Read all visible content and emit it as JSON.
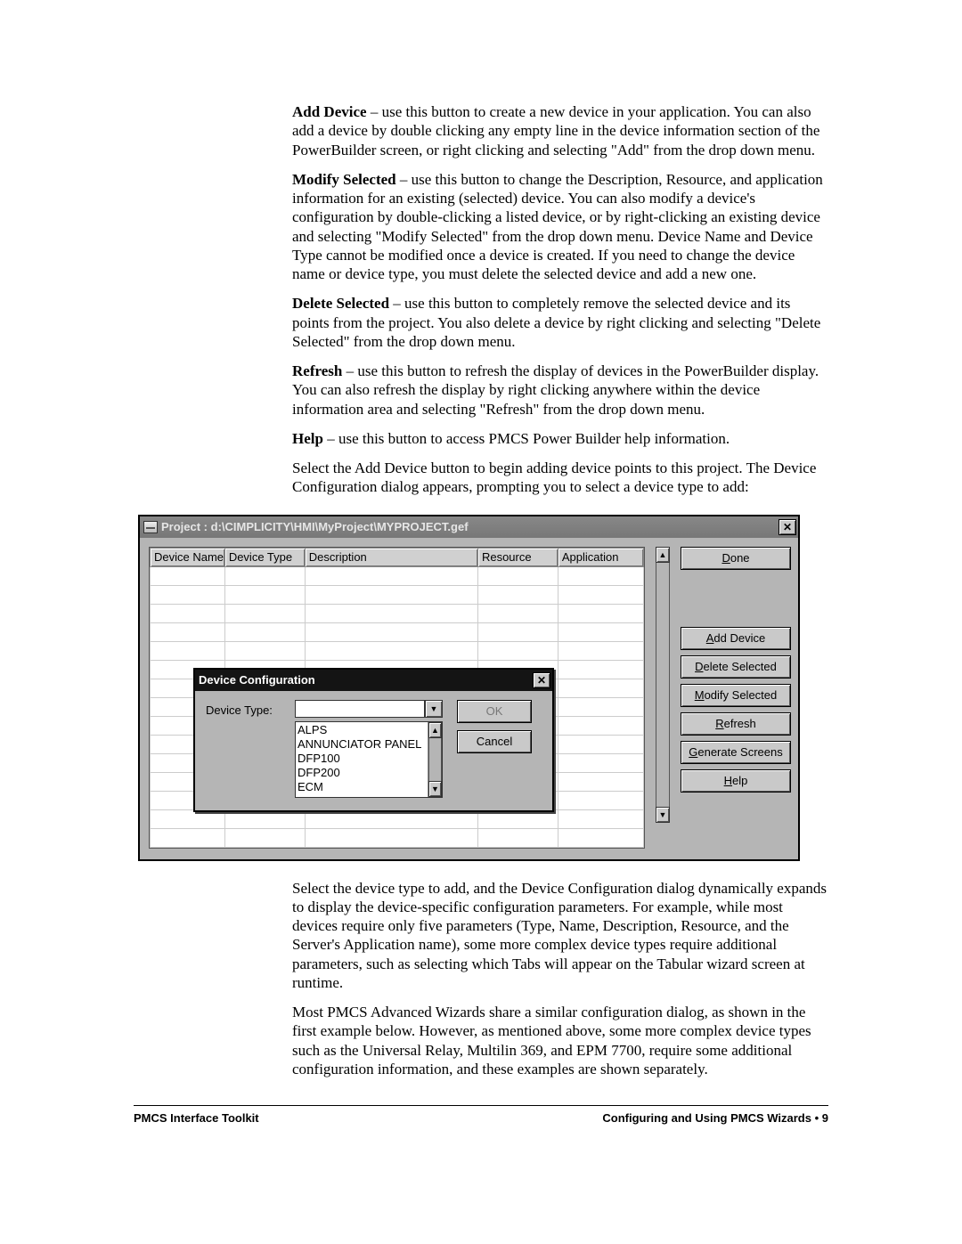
{
  "paragraphs": {
    "p1_bold": "Add Device",
    "p1_rest": " – use this button to create a new device in your application. You can also add a device by double clicking any empty line in the device information section of the PowerBuilder screen, or right clicking and selecting \"Add\" from the drop down menu.",
    "p2_bold": "Modify Selected",
    "p2_rest": " – use this button to change the Description, Resource, and application information for an existing (selected) device. You can also modify a device's configuration by double-clicking a listed device, or by right-clicking an existing device and selecting \"Modify Selected\" from the drop down menu. Device Name and Device Type cannot be modified once a device is created. If you need to change the device name or device type, you must delete the selected device and add a new one.",
    "p3_bold": "Delete Selected",
    "p3_rest": " – use this button to completely remove the selected device and its points from the project. You also delete a device by right clicking and selecting \"Delete Selected\" from the drop down menu.",
    "p4_bold": "Refresh",
    "p4_rest": " – use this button to refresh the display of devices in the PowerBuilder display. You can also refresh the display by right clicking anywhere within the device information area and selecting \"Refresh\" from the drop down menu.",
    "p5_bold": "Help",
    "p5_rest": " – use this button to access PMCS Power Builder help information.",
    "p6": "Select the Add Device button to begin adding device points to this project. The Device Configuration dialog appears, prompting you to select a device type to add:",
    "p7": "Select the device type to add, and the Device Configuration dialog dynamically expands to display the device-specific configuration parameters. For example, while most devices require only five parameters (Type, Name, Description, Resource, and the Server's Application name), some more complex device types require additional parameters, such as selecting which Tabs will appear on the Tabular wizard screen at runtime.",
    "p8": "Most PMCS Advanced Wizards share a similar configuration dialog, as shown in the first example below. However, as mentioned above, some more complex device types such as the Universal Relay, Multilin 369, and EPM 7700, require some additional configuration information, and these examples are shown separately."
  },
  "window": {
    "title": "Project : d:\\CIMPLICITY\\HMI\\MyProject\\MYPROJECT.gef",
    "close_glyph": "✕",
    "columns": [
      "Device Name",
      "Device Type",
      "Description",
      "Resource",
      "Application"
    ],
    "buttons": {
      "done": "Done",
      "add": "Add Device",
      "delete": "Delete Selected",
      "modify": "Modify Selected",
      "refresh": "Refresh",
      "generate": "Generate Screens",
      "help": "Help"
    }
  },
  "dialog": {
    "title": "Device Configuration",
    "label": "Device Type:",
    "options": [
      "ALPS",
      "ANNUNCIATOR PANEL",
      "DFP100",
      "DFP200",
      "ECM"
    ],
    "ok": "OK",
    "cancel": "Cancel",
    "close_glyph": "✕",
    "up_glyph": "▲",
    "down_glyph": "▼"
  },
  "footer": {
    "left": "PMCS Interface Toolkit",
    "right_prefix": "Configuring and Using PMCS Wizards",
    "right_sep": "  •  ",
    "right_page": "9"
  }
}
